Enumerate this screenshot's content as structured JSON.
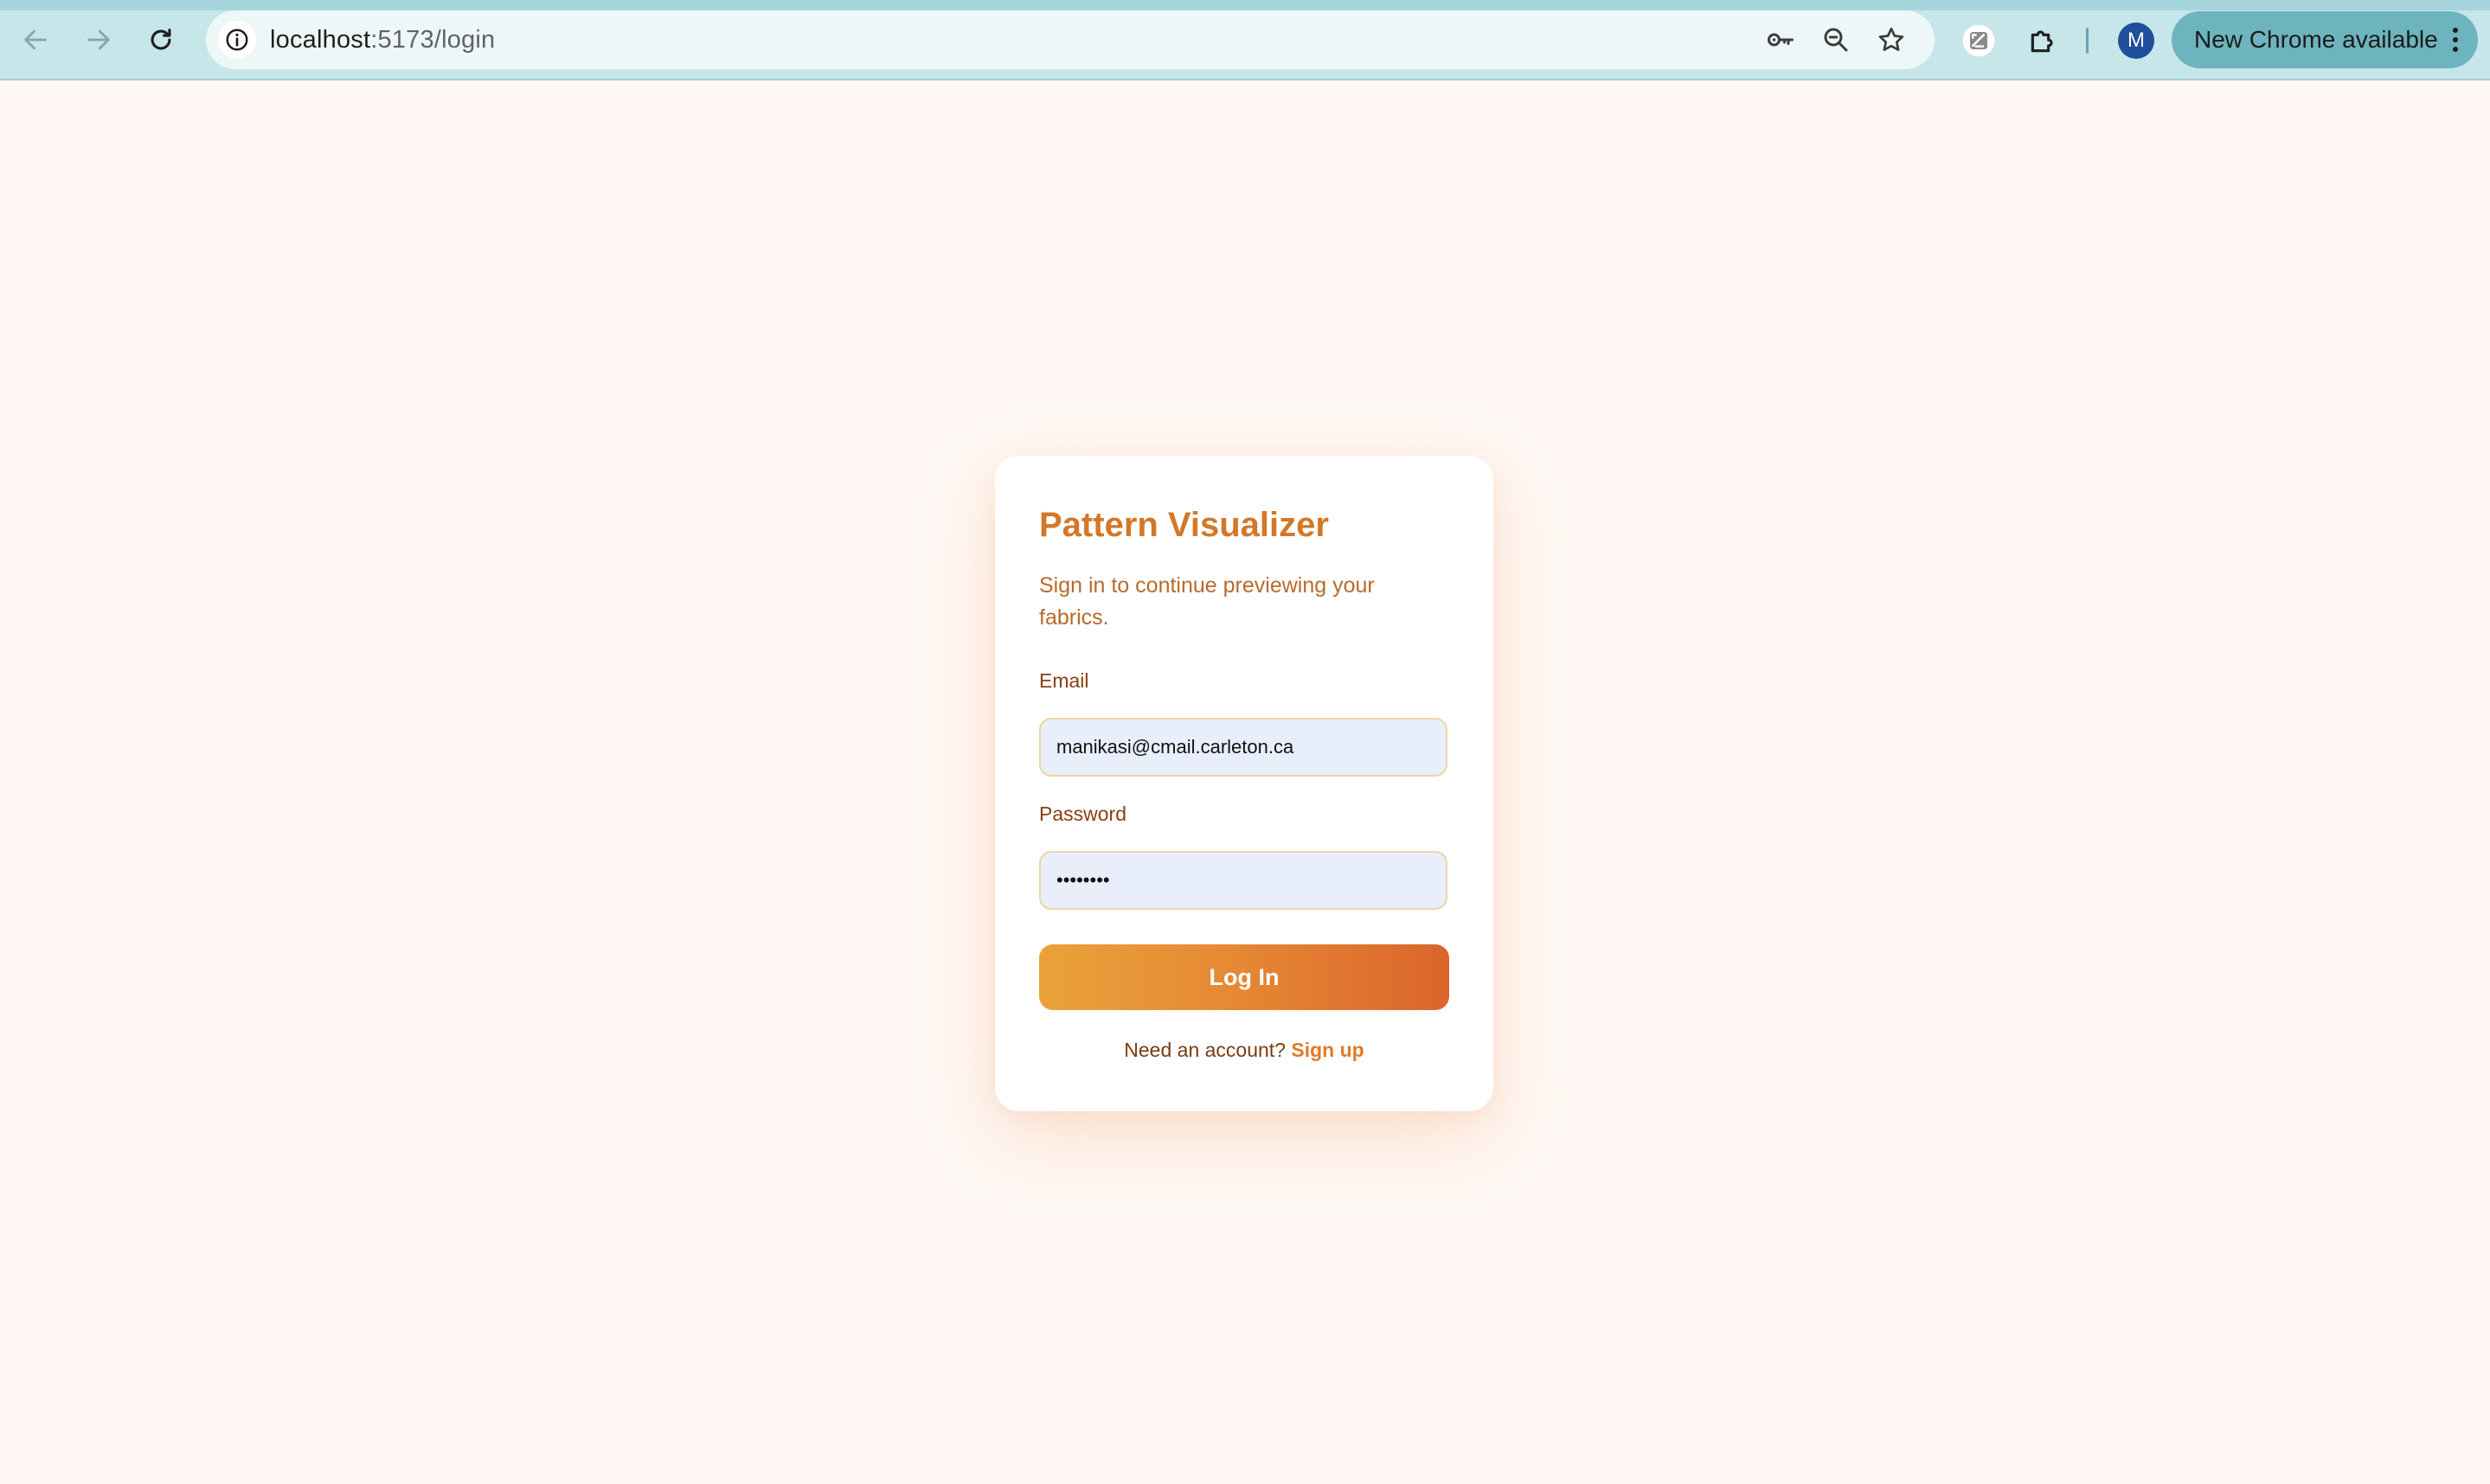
{
  "browser": {
    "url_host": "localhost",
    "url_path": ":5173/login",
    "profile_initial": "M",
    "update_label": "New Chrome available",
    "icons": {
      "back": "arrow-left-icon",
      "forward": "arrow-right-icon",
      "reload": "reload-icon",
      "site_info": "info-icon",
      "passwords": "key-icon",
      "zoom": "zoom-icon",
      "bookmark": "star-icon",
      "extension": "extension-icon",
      "extensions_menu": "puzzle-icon",
      "menu": "more-vert-icon"
    }
  },
  "login": {
    "title": "Pattern Visualizer",
    "subtitle": "Sign in to continue previewing your fabrics.",
    "email_label": "Email",
    "email_value": "manikasi@cmail.carleton.ca",
    "password_label": "Password",
    "password_value": "••••••••",
    "submit_label": "Log In",
    "signup_prompt": "Need an account?",
    "signup_link": "Sign up"
  },
  "colors": {
    "page_background": "#fff8f4",
    "accent": "#d2782a",
    "button_gradient_start": "#eaa23a",
    "button_gradient_end": "#dc652c",
    "input_background": "#e8effb",
    "chrome_toolbar": "#c6e6ea"
  }
}
